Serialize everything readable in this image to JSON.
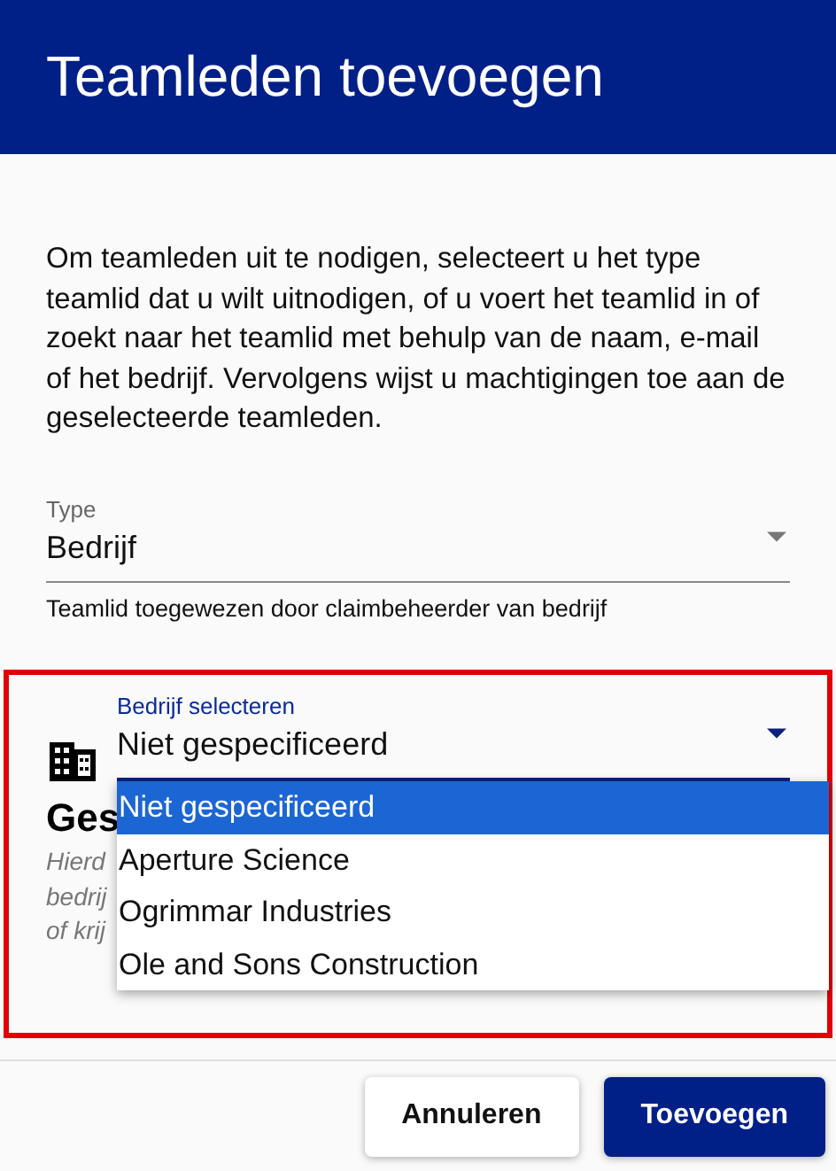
{
  "header": {
    "title": "Teamleden toevoegen"
  },
  "intro": "Om teamleden uit te nodigen, selecteert u het type teamlid dat u wilt uitnodigen, of u voert het teamlid in of zoekt naar het teamlid met behulp van de naam, e-mail of het bedrijf. Vervolgens wijst u machtigingen toe aan de geselecteerde teamleden.",
  "type_field": {
    "label": "Type",
    "value": "Bedrijf",
    "hint": "Teamlid toegewezen door claimbeheerder van bedrijf"
  },
  "company_field": {
    "label": "Bedrijf selecteren",
    "value": "Niet gespecificeerd",
    "expanded": true,
    "options": [
      {
        "label": "Niet gespecificeerd",
        "selected": true
      },
      {
        "label": "Aperture Science",
        "selected": false
      },
      {
        "label": "Ogrimmar Industries",
        "selected": false
      },
      {
        "label": "Ole and Sons Construction",
        "selected": false
      }
    ]
  },
  "section": {
    "heading": "Ges",
    "lines": [
      "Hierd",
      "bedrij",
      "of krij"
    ]
  },
  "buttons": [
    {
      "label": "Annuleren",
      "kind": "secondary"
    },
    {
      "label": "Toevoegen",
      "kind": "primary"
    }
  ]
}
